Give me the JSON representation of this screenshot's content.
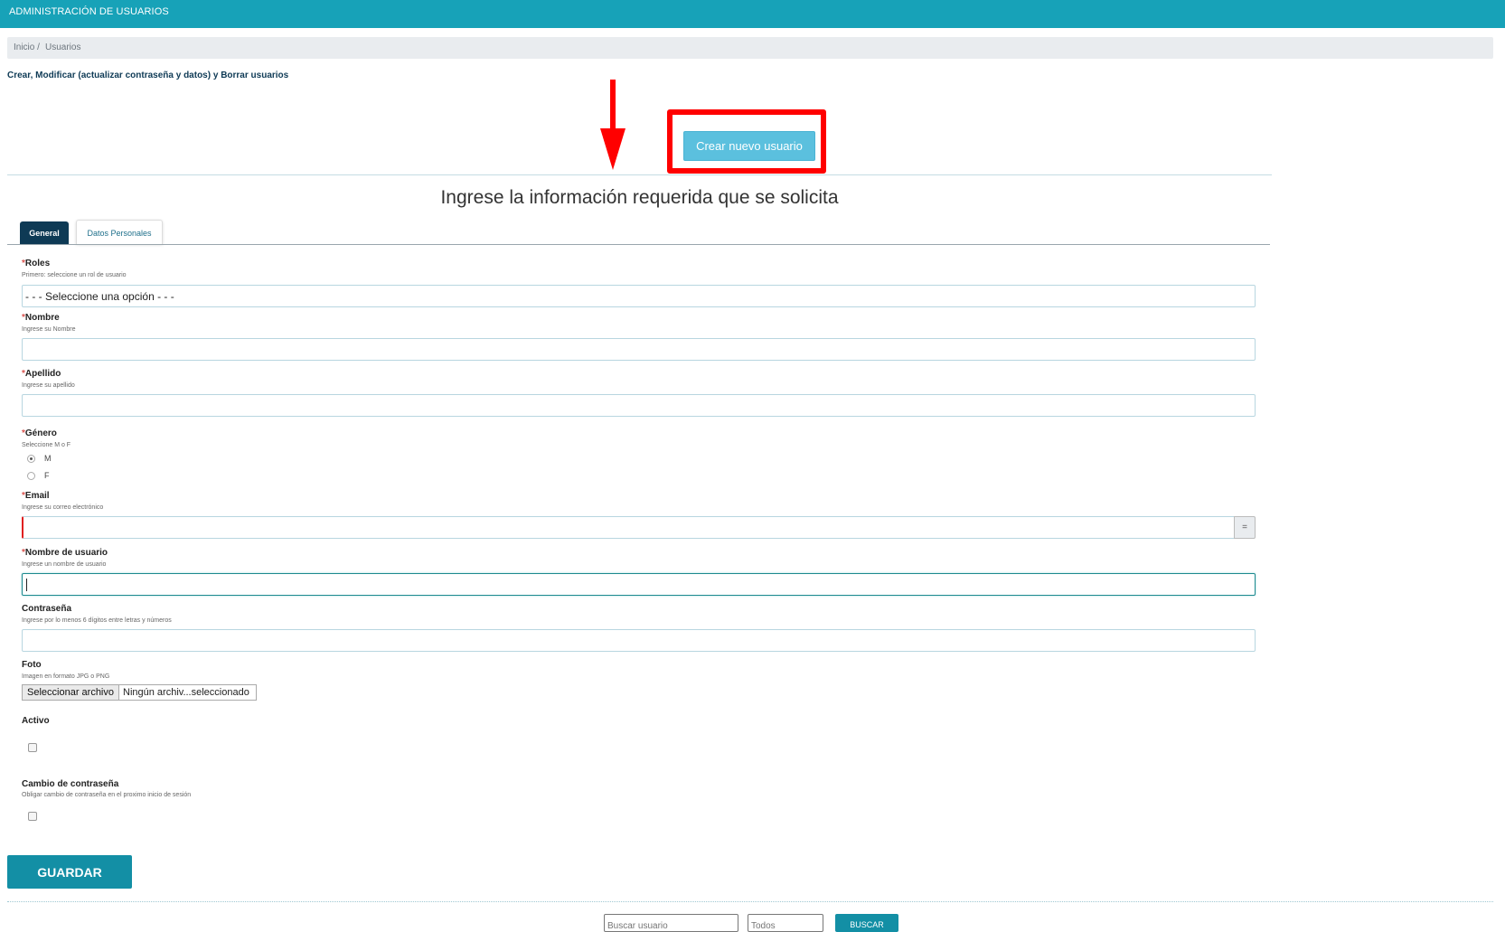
{
  "header": {
    "title": "ADMINISTRACIÓN DE USUARIOS"
  },
  "breadcrumb": {
    "home": "Inicio /",
    "current": "Usuarios"
  },
  "page": {
    "subtitle": "Crear, Modificar (actualizar contraseña y datos) y Borrar usuarios",
    "create_button": "Crear nuevo usuario",
    "form_title": "Ingrese la información requerida que se solicita"
  },
  "tabs": [
    {
      "label": "General",
      "active": true
    },
    {
      "label": "Datos Personales",
      "active": false
    }
  ],
  "form": {
    "required_mark": "*",
    "roles": {
      "label": "Roles",
      "hint": "Primero: seleccione un rol de usuario",
      "selected": "- - - Seleccione una opción - - -"
    },
    "nombre": {
      "label": "Nombre",
      "hint": "Ingrese su Nombre",
      "value": ""
    },
    "apellido": {
      "label": "Apellido",
      "hint": "Ingrese su apellido",
      "value": ""
    },
    "genero": {
      "label": "Género",
      "hint": "Seleccione M o F",
      "options": [
        "M",
        "F"
      ],
      "selected": "M"
    },
    "email": {
      "label": "Email",
      "hint": "Ingrese su correo electrónico",
      "value": "",
      "addon": "="
    },
    "usuario": {
      "label": "Nombre de usuario",
      "hint": "Ingrese un nombre de usuario",
      "value": ""
    },
    "contrasena": {
      "label": "Contraseña",
      "hint": "Ingrese por lo menos 6 dígitos entre letras y números",
      "value": ""
    },
    "foto": {
      "label": "Foto",
      "hint": "Imagen en formato JPG o PNG",
      "button": "Seleccionar archivo",
      "status": "Ningún archiv...seleccionado"
    },
    "activo": {
      "label": "Activo",
      "checked": false
    },
    "cambio": {
      "label": "Cambio de contraseña",
      "hint": "Obligar cambio de contraseña en el proximo inicio de sesión",
      "checked": false
    },
    "save_button": "GUARDAR"
  },
  "search": {
    "placeholder": "Buscar usuario",
    "filter": "Todos",
    "button": "BUSCAR"
  },
  "colors": {
    "header": "#17a2b8",
    "highlight": "#ff0000",
    "accent": "#138fa5",
    "tab_active": "#0e3a55",
    "create_button": "#5bc0de"
  }
}
